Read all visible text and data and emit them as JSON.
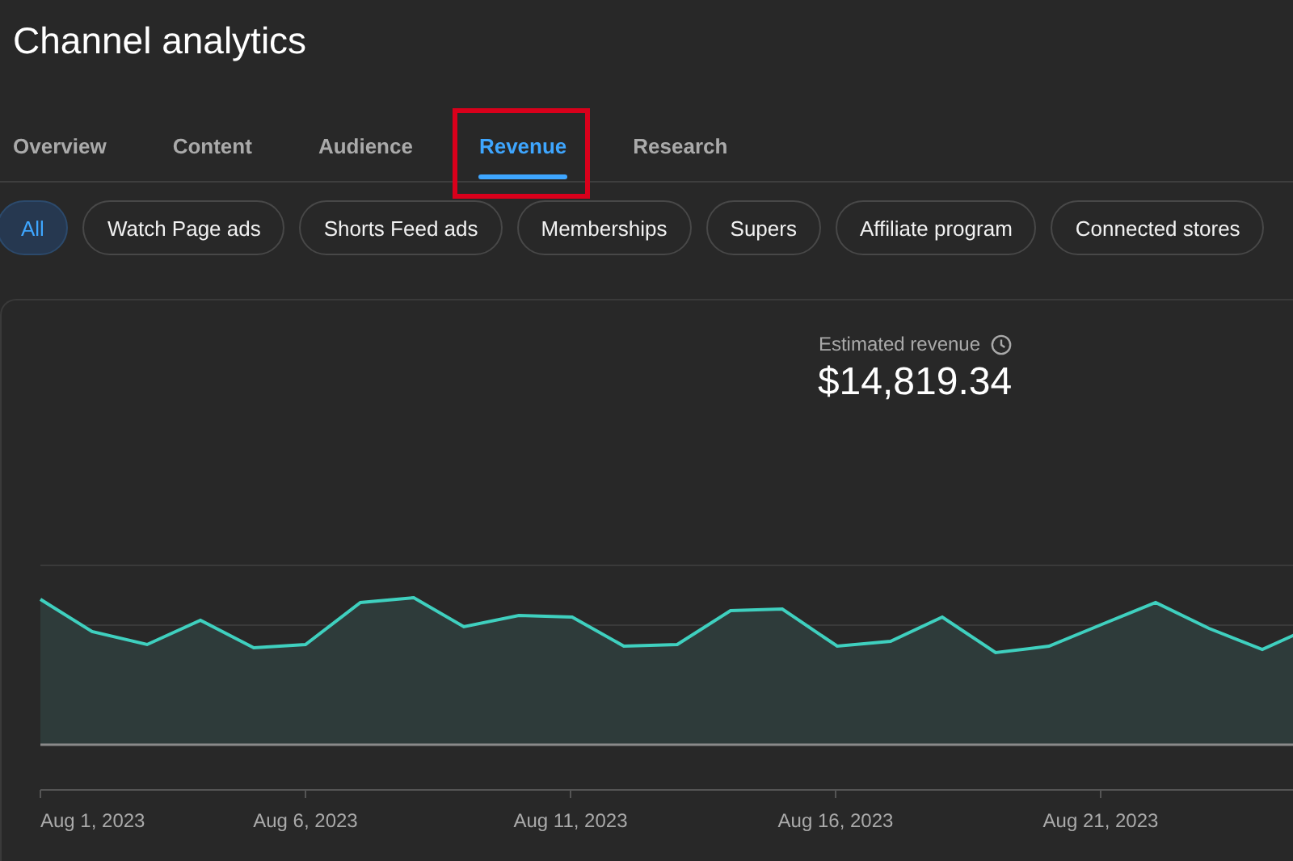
{
  "page": {
    "title": "Channel analytics"
  },
  "tabs": [
    {
      "label": "Overview",
      "selected": false,
      "highlighted": false
    },
    {
      "label": "Content",
      "selected": false,
      "highlighted": false
    },
    {
      "label": "Audience",
      "selected": false,
      "highlighted": false
    },
    {
      "label": "Revenue",
      "selected": true,
      "highlighted": true
    },
    {
      "label": "Research",
      "selected": false,
      "highlighted": false
    }
  ],
  "filters": [
    {
      "label": "All",
      "selected": true
    },
    {
      "label": "Watch Page ads",
      "selected": false
    },
    {
      "label": "Shorts Feed ads",
      "selected": false
    },
    {
      "label": "Memberships",
      "selected": false
    },
    {
      "label": "Supers",
      "selected": false
    },
    {
      "label": "Affiliate program",
      "selected": false
    },
    {
      "label": "Connected stores",
      "selected": false
    }
  ],
  "metric": {
    "label": "Estimated revenue",
    "value": "$14,819.34"
  },
  "chart": {
    "x_axis_labels": [
      "Aug 1, 2023",
      "Aug 6, 2023",
      "Aug 11, 2023",
      "Aug 16, 2023",
      "Aug 21, 2023"
    ]
  }
}
